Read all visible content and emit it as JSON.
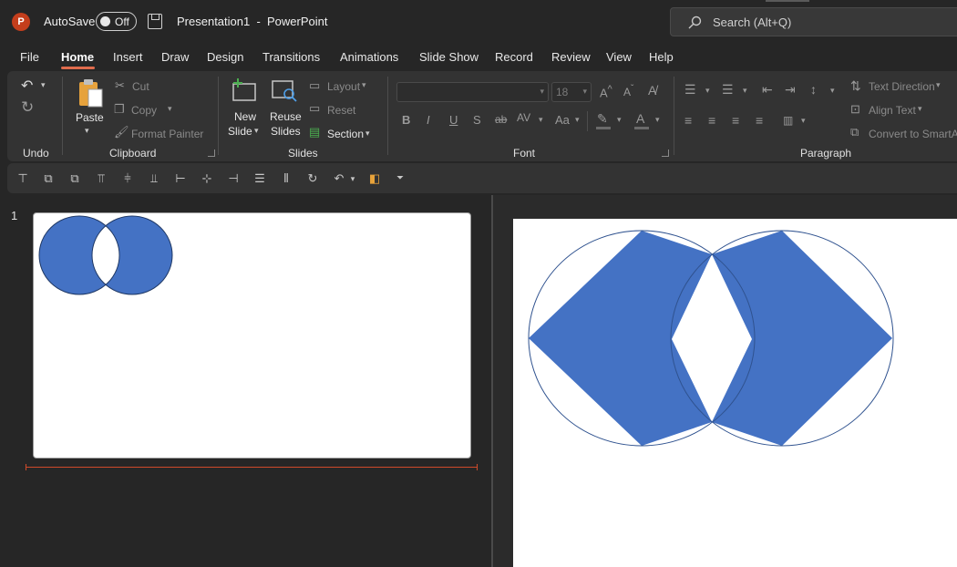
{
  "app": {
    "logo_letter": "P",
    "autosave_label": "AutoSave",
    "autosave_state": "Off",
    "title": "Presentation1  -  PowerPoint",
    "search_placeholder": "Search (Alt+Q)"
  },
  "tabs": [
    "File",
    "Home",
    "Insert",
    "Draw",
    "Design",
    "Transitions",
    "Animations",
    "Slide Show",
    "Record",
    "Review",
    "View",
    "Help"
  ],
  "active_tab": "Home",
  "ribbon": {
    "groups": {
      "undo": "Undo",
      "clipboard": "Clipboard",
      "slides": "Slides",
      "font": "Font",
      "paragraph": "Paragraph"
    },
    "clipboard": {
      "paste": "Paste",
      "cut": "Cut",
      "copy": "Copy",
      "format_painter": "Format Painter"
    },
    "slides": {
      "new_slide_1": "New",
      "new_slide_2": "Slide",
      "reuse_1": "Reuse",
      "reuse_2": "Slides",
      "layout": "Layout",
      "reset": "Reset",
      "section": "Section"
    },
    "font": {
      "font_name": "",
      "font_size": "18"
    },
    "paragraph": {
      "text_direction": "Text Direction",
      "align_text": "Align Text",
      "convert": "Convert to SmartA"
    }
  },
  "thumbnails": {
    "slide_number": "1"
  },
  "colors": {
    "accent": "#c43e1c",
    "shape_fill": "#4472c4",
    "shape_outline": "#2f528f"
  }
}
